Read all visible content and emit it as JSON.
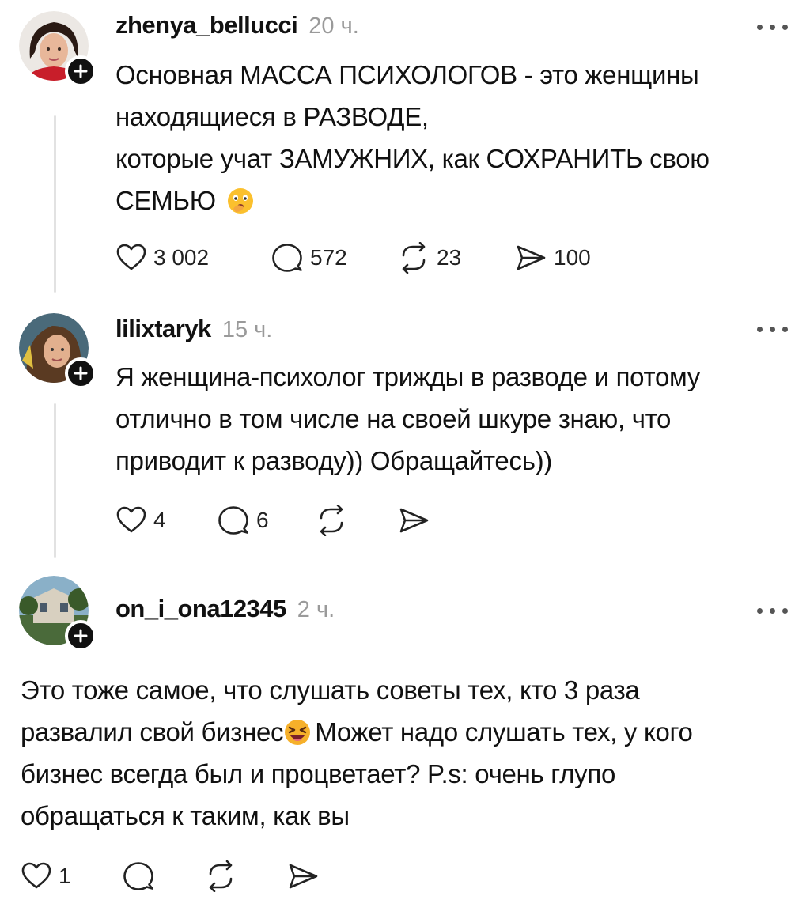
{
  "posts": [
    {
      "username": "zhenya_bellucci",
      "time": "20 ч.",
      "text_lines": [
        "Основная МАССА ПСИХОЛОГОВ - это женщины",
        "находящиеся в РАЗВОДЕ,",
        "которые учат ЗАМУЖНИХ, как СОХРАНИТЬ свою",
        "СЕМЬЮ"
      ],
      "emoji": "shushing-face-emoji",
      "likes": "3 002",
      "comments": "572",
      "reposts": "23",
      "shares": "100"
    },
    {
      "username": "lilixtaryk",
      "time": "15 ч.",
      "text_lines": [
        "Я женщина-психолог трижды в разводе и потому",
        "отлично в том числе на своей шкуре знаю, что",
        "приводит к разводу)) Обращайтесь))"
      ],
      "likes": "4",
      "comments": "6",
      "reposts": "",
      "shares": ""
    },
    {
      "username": "on_i_ona12345",
      "time": "2 ч.",
      "text_lines_before_emoji": "развалил свой бизнес",
      "text_line_1": "Это тоже самое, что слушать советы тех, кто 3 раза",
      "text_line_2_after_emoji": "Может надо слушать тех, у кого",
      "text_line_3": "бизнес всегда был и процветает? P.s: очень глупо",
      "text_line_4": "обращаться к таким, как вы",
      "emoji": "laughing-face-emoji",
      "likes": "1",
      "comments": "",
      "reposts": "",
      "shares": ""
    }
  ],
  "icons": {
    "like": "heart-icon",
    "comment": "comment-bubble-icon",
    "repost": "repost-icon",
    "share": "send-icon",
    "more": "more-dots-icon",
    "follow": "plus-icon"
  },
  "colors": {
    "text": "#111111",
    "muted": "#9a9a9a",
    "thread": "#e2e2e2"
  }
}
